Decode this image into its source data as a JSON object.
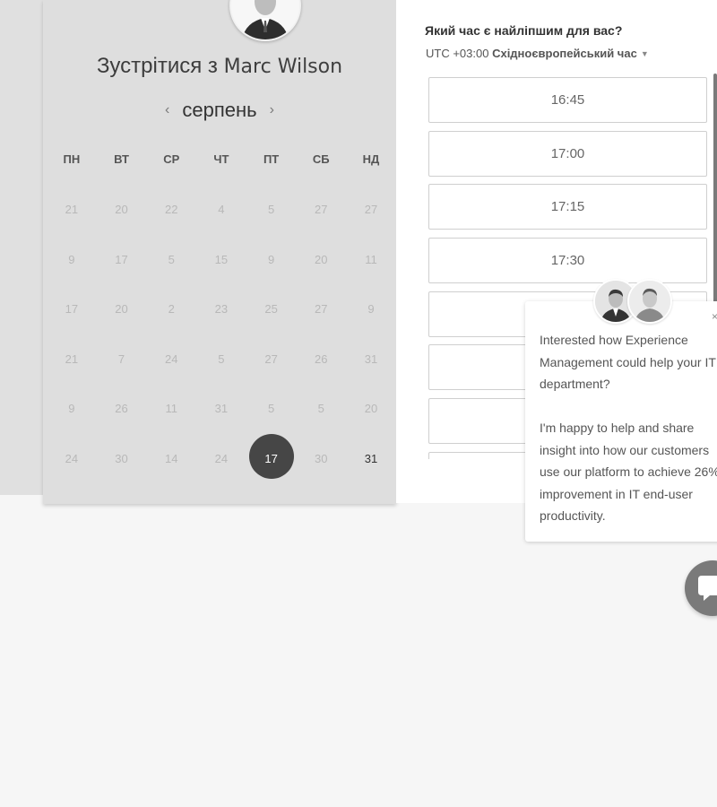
{
  "scheduler": {
    "title_prefix": "Зустрітися з",
    "host_name": "Marc Wilson",
    "month": "серпень",
    "weekdays": [
      "ПН",
      "ВТ",
      "СР",
      "ЧТ",
      "ПТ",
      "СБ",
      "НД"
    ],
    "weeks": [
      [
        "21",
        "20",
        "22",
        "4",
        "5",
        "27",
        "27"
      ],
      [
        "9",
        "17",
        "5",
        "15",
        "9",
        "20",
        "11"
      ],
      [
        "17",
        "20",
        "2",
        "23",
        "25",
        "27",
        "9"
      ],
      [
        "21",
        "7",
        "24",
        "5",
        "27",
        "26",
        "31"
      ],
      [
        "9",
        "26",
        "11",
        "31",
        "5",
        "5",
        "20"
      ],
      [
        "24",
        "30",
        "14",
        "24",
        "17",
        "30",
        "31"
      ]
    ],
    "selected_day": "17",
    "available_day": "31"
  },
  "times": {
    "question": "Який час є найліпшим для вас?",
    "timezone_offset": "UTC +03:00",
    "timezone_name": "Східноєвропейський час",
    "slots": [
      "16:45",
      "17:00",
      "17:15",
      "17:30",
      "",
      "",
      "",
      ""
    ]
  },
  "chat": {
    "message_1": "Interested how Experience Management could help your IT department?",
    "message_2": "I'm happy to help and share insight into how our customers use our platform to achieve 26% improvement in IT end-user productivity.",
    "close_symbol": "×"
  },
  "icons": {
    "prev": "chevron-left-icon",
    "next": "chevron-right-icon",
    "timezone_caret": "caret-down-icon",
    "launcher": "chat-bubble-icon"
  },
  "colors": {
    "selected_day_bg": "#464646",
    "calendar_bg": "#dedede",
    "launcher_bg": "#7a7a7a"
  }
}
